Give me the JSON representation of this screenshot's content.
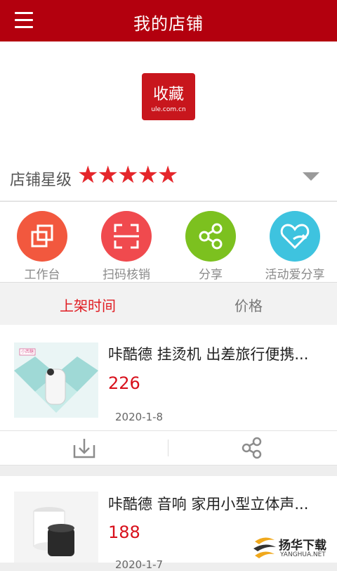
{
  "header": {
    "title": "我的店铺"
  },
  "store": {
    "logo_text": "收藏",
    "logo_url": "ule.com.cn",
    "rating_label": "店铺星级",
    "stars": "★★★★★",
    "rating": 5
  },
  "actions": [
    {
      "label": "工作台",
      "icon": "window-stack-icon",
      "color": "#f2583e"
    },
    {
      "label": "扫码核销",
      "icon": "scan-frame-icon",
      "color": "#f04a4e"
    },
    {
      "label": "分享",
      "icon": "share-nodes-icon",
      "color": "#7cc11f"
    },
    {
      "label": "活动爱分享",
      "icon": "heart-share-icon",
      "color": "#3ec3df"
    }
  ],
  "sort_tabs": [
    {
      "label": "上架时间",
      "active": true
    },
    {
      "label": "价格",
      "active": false
    }
  ],
  "products": [
    {
      "name": "咔酷德 挂烫机 出差旅行便携...",
      "price": "226",
      "date": "2020-1-8",
      "thumb_tag": "小西糖"
    },
    {
      "name": "咔酷德 音响 家用小型立体声...",
      "price": "188",
      "date": "2020-1-7"
    }
  ],
  "watermark": {
    "cn": "扬华下载",
    "en": "YANGHUA.NET"
  }
}
